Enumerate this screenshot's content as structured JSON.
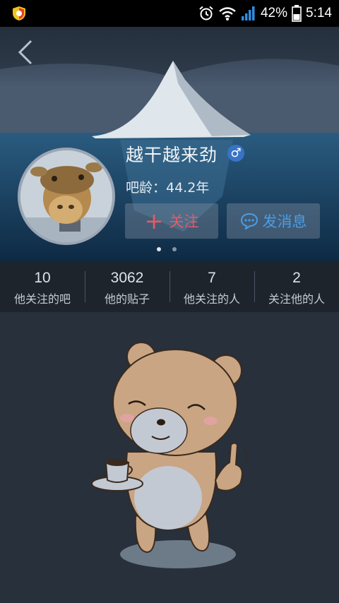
{
  "status_bar": {
    "battery": "42%",
    "time": "5:14",
    "icons": [
      "shield-icon",
      "alarm-icon",
      "wifi-icon",
      "signal-icon",
      "battery-icon"
    ]
  },
  "profile": {
    "username": "越干越来劲",
    "gender_symbol": "♂",
    "age_label": "吧龄：44.2年",
    "follow_button": "关注",
    "follow_icon": "+",
    "message_button": "发消息",
    "pager": {
      "pages": 2,
      "active": 1
    }
  },
  "stats": [
    {
      "value": "10",
      "label": "他关注的吧"
    },
    {
      "value": "3062",
      "label": "他的贴子"
    },
    {
      "value": "7",
      "label": "他关注的人"
    },
    {
      "value": "2",
      "label": "关注他的人"
    }
  ],
  "colors": {
    "follow": "#e85a64",
    "message": "#4a9de6",
    "gender_badge": "#3774c8",
    "background": "#27303b"
  }
}
